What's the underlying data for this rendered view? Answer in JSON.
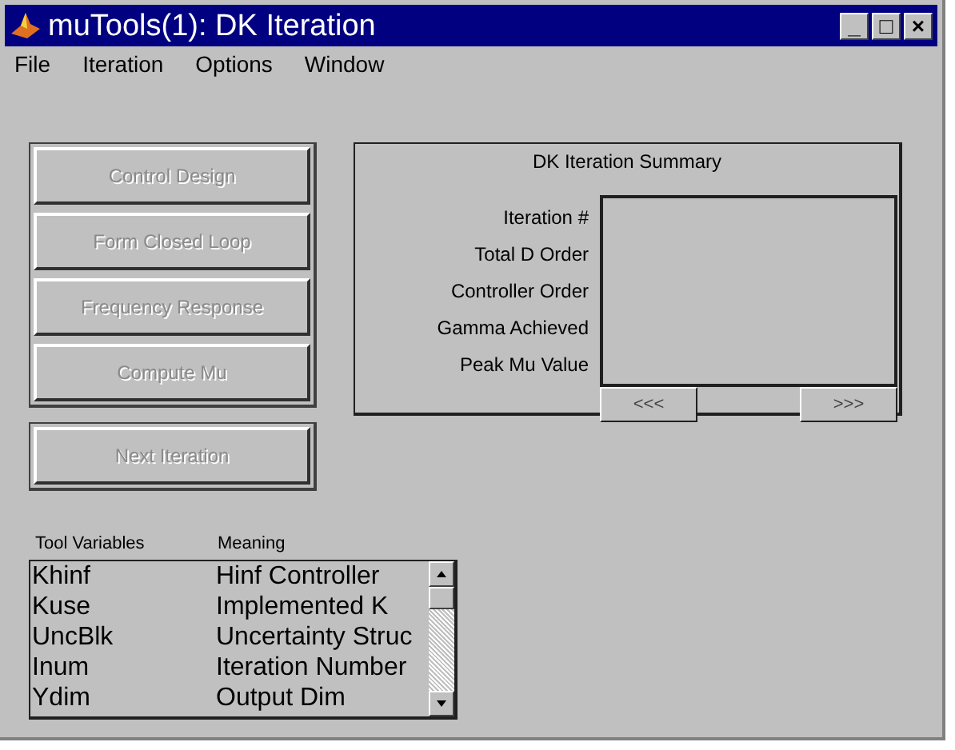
{
  "window": {
    "title": "muTools(1): DK Iteration",
    "controls": [
      "_",
      "□",
      "×"
    ]
  },
  "menu": [
    "File",
    "Iteration",
    "Options",
    "Window"
  ],
  "action_buttons": [
    {
      "label": "Control Design",
      "disabled": true
    },
    {
      "label": "Form Closed Loop",
      "disabled": true
    },
    {
      "label": "Frequency Response",
      "disabled": true
    },
    {
      "label": "Compute Mu",
      "disabled": true
    }
  ],
  "next_button": {
    "label": "Next Iteration",
    "disabled": true
  },
  "summary": {
    "title": "DK Iteration Summary",
    "labels": [
      "Iteration #",
      "Total D Order",
      "Controller Order",
      "Gamma Achieved",
      "Peak Mu Value"
    ],
    "prev": "<<<",
    "next": ">>>"
  },
  "variables": {
    "columns": [
      "Tool Variables",
      "Meaning"
    ],
    "rows": [
      {
        "name": "Khinf",
        "meaning": "Hinf Controller"
      },
      {
        "name": "Kuse",
        "meaning": "Implemented K"
      },
      {
        "name": "UncBlk",
        "meaning": "Uncertainty Struc"
      },
      {
        "name": "Inum",
        "meaning": "Iteration Number"
      },
      {
        "name": "Ydim",
        "meaning": "Output Dim"
      }
    ]
  }
}
